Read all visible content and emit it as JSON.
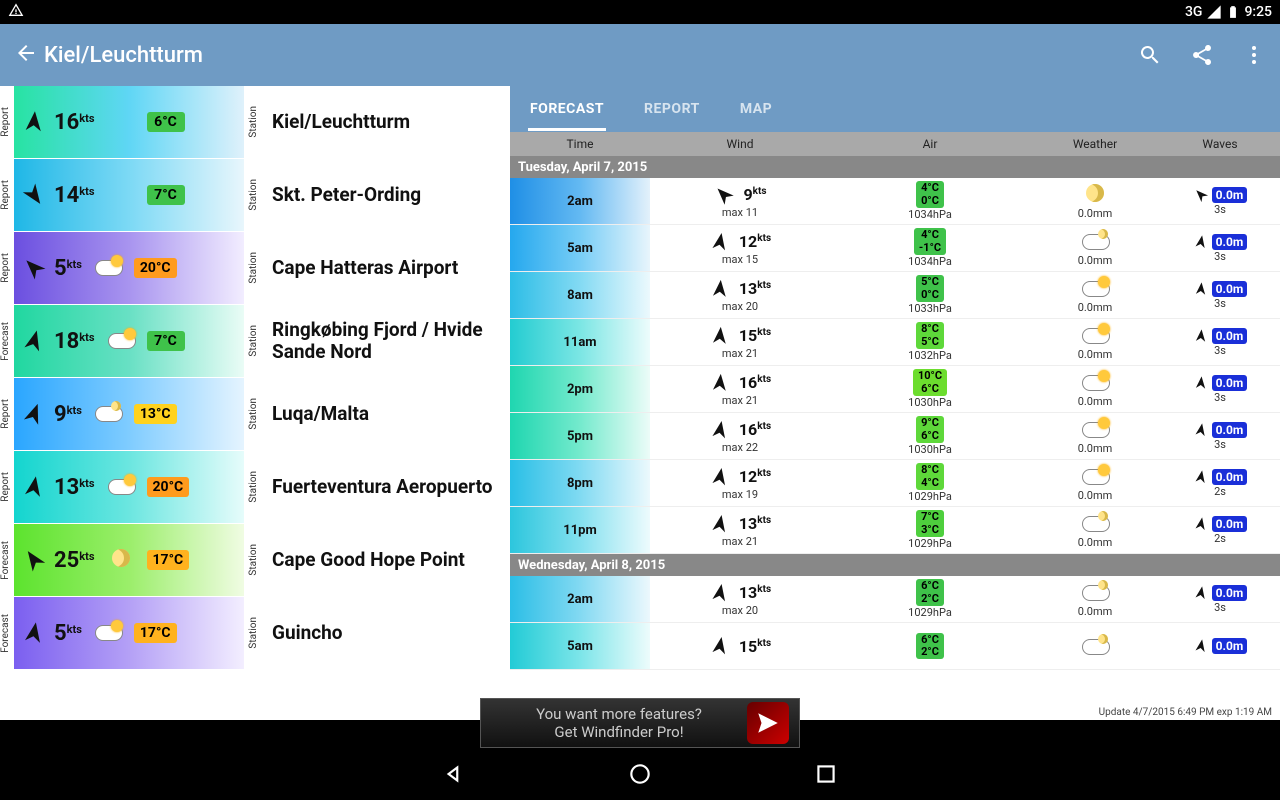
{
  "statusbar": {
    "net": "3G",
    "time": "9:25"
  },
  "toolbar": {
    "title": "Kiel/Leuchtturm"
  },
  "tabs": [
    "FORECAST",
    "REPORT",
    "MAP"
  ],
  "columns": {
    "time": "Time",
    "wind": "Wind",
    "air": "Air",
    "weather": "Weather",
    "waves": "Waves"
  },
  "kts_unit": "kts",
  "stations": [
    {
      "tag": "Report",
      "speed": "16",
      "temp": "6°C",
      "tempbg": "#3fc24a",
      "name": "Kiel/Leuchtturm",
      "grad": "linear-gradient(90deg,#27e3a2,#5fd6f5,#dff1fb)",
      "rot": 95,
      "icon": ""
    },
    {
      "tag": "Report",
      "speed": "14",
      "temp": "7°C",
      "tempbg": "#3fc24a",
      "name": "Skt. Peter-Ording",
      "grad": "linear-gradient(90deg,#1fb7e6,#7cd9f5,#e8f6fc)",
      "rot": 235,
      "icon": ""
    },
    {
      "tag": "Report",
      "speed": "5",
      "temp": "20°C",
      "tempbg": "#ff9b1e",
      "name": "Cape Hatteras Airport",
      "grad": "linear-gradient(90deg,#6b4fe0,#a894ef,#f2edff)",
      "rot": 45,
      "icon": "cloud sun"
    },
    {
      "tag": "Forecast",
      "speed": "18",
      "temp": "7°C",
      "tempbg": "#3fc24a",
      "name": "Ringkøbing Fjord / Hvide Sande Nord",
      "grad": "linear-gradient(90deg,#20d7a0,#68e0c4,#eafcf6)",
      "rot": 105,
      "icon": "cloud sun"
    },
    {
      "tag": "Report",
      "speed": "9",
      "temp": "13°C",
      "tempbg": "#ffd21e",
      "name": "Luqa/Malta",
      "grad": "linear-gradient(90deg,#2aa6ff,#7fccff,#e5f4ff)",
      "rot": 110,
      "icon": "cloud moon"
    },
    {
      "tag": "Report",
      "speed": "13",
      "temp": "20°C",
      "tempbg": "#ff9b1e",
      "name": "Fuerteventura Aeropuerto",
      "grad": "linear-gradient(90deg,#13d5cf,#6be6e0,#e6fcfb)",
      "rot": 100,
      "icon": "cloud sun"
    },
    {
      "tag": "Forecast",
      "speed": "25",
      "temp": "17°C",
      "tempbg": "#ffb21e",
      "name": "Cape Good Hope Point",
      "grad": "linear-gradient(90deg,#5ce32e,#9bee6a,#f0fce3)",
      "rot": 55,
      "icon": "moononly"
    },
    {
      "tag": "Forecast",
      "speed": "5",
      "temp": "17°C",
      "tempbg": "#ffb21e",
      "name": "Guincho",
      "grad": "linear-gradient(90deg,#7b5ff0,#b4a0f6,#f3eeff)",
      "rot": 100,
      "icon": "cloud sun"
    }
  ],
  "days": [
    {
      "label": "Tuesday, April 7, 2015",
      "rows": [
        {
          "t": "2am",
          "sp": "9",
          "mx": "max 11",
          "t1": "4°C",
          "t2": "0°C",
          "tbg": "#3fc24a",
          "hp": "1034hPa",
          "wic": "moononly",
          "mm": "0.0mm",
          "wv": "0.0m",
          "ws": "3s",
          "grad": "linear-gradient(90deg,#1f8fe6,#63b9f2,#e3f1fb)",
          "rot": 45
        },
        {
          "t": "5am",
          "sp": "12",
          "mx": "max 15",
          "t1": "4°C",
          "t2": "-1°C",
          "tbg": "#3fc24a",
          "hp": "1034hPa",
          "wic": "cloud moon",
          "mm": "0.0mm",
          "wv": "0.0m",
          "ws": "3s",
          "grad": "linear-gradient(90deg,#25a8ee,#77cdf6,#e8f5fc)",
          "rot": 100
        },
        {
          "t": "8am",
          "sp": "13",
          "mx": "max 20",
          "t1": "5°C",
          "t2": "0°C",
          "tbg": "#3fc24a",
          "hp": "1033hPa",
          "wic": "cloud sun",
          "mm": "0.0mm",
          "wv": "0.0m",
          "ws": "3s",
          "grad": "linear-gradient(90deg,#2dbde6,#83daf3,#ecf9fd)",
          "rot": 95
        },
        {
          "t": "11am",
          "sp": "15",
          "mx": "max 21",
          "t1": "8°C",
          "t2": "5°C",
          "tbg": "#5ed83a",
          "hp": "1032hPa",
          "wic": "cloud sun",
          "mm": "0.0mm",
          "wv": "0.0m",
          "ws": "3s",
          "grad": "linear-gradient(90deg,#23ccd1,#7be6e4,#edfcfc)",
          "rot": 95
        },
        {
          "t": "2pm",
          "sp": "16",
          "mx": "max 21",
          "t1": "10°C",
          "t2": "6°C",
          "tbg": "#6cdd2e",
          "hp": "1030hPa",
          "wic": "cloud sun",
          "mm": "0.0mm",
          "wv": "0.0m",
          "ws": "3s",
          "grad": "linear-gradient(90deg,#1fd6b0,#74eacd,#ecfcf8)",
          "rot": 95
        },
        {
          "t": "5pm",
          "sp": "16",
          "mx": "max 22",
          "t1": "9°C",
          "t2": "6°C",
          "tbg": "#5ed83a",
          "hp": "1030hPa",
          "wic": "cloud sun",
          "mm": "0.0mm",
          "wv": "0.0m",
          "ws": "3s",
          "grad": "linear-gradient(90deg,#1fd6b0,#74eacd,#ecfcf8)",
          "rot": 100
        },
        {
          "t": "8pm",
          "sp": "12",
          "mx": "max 19",
          "t1": "8°C",
          "t2": "4°C",
          "tbg": "#5ed83a",
          "hp": "1029hPa",
          "wic": "cloud sun",
          "mm": "0.0mm",
          "wv": "0.0m",
          "ws": "2s",
          "grad": "linear-gradient(90deg,#29bfe6,#80daf2,#ecf9fd)",
          "rot": 100
        },
        {
          "t": "11pm",
          "sp": "13",
          "mx": "max 21",
          "t1": "7°C",
          "t2": "3°C",
          "tbg": "#4ecf3d",
          "hp": "1029hPa",
          "wic": "cloud moon",
          "mm": "0.0mm",
          "wv": "0.0m",
          "ws": "2s",
          "grad": "linear-gradient(90deg,#2cc6dd,#83e0ef,#edfbfd)",
          "rot": 100
        }
      ]
    },
    {
      "label": "Wednesday, April 8, 2015",
      "rows": [
        {
          "t": "2am",
          "sp": "13",
          "mx": "max 20",
          "t1": "6°C",
          "t2": "2°C",
          "tbg": "#3fc24a",
          "hp": "1029hPa",
          "wic": "cloud moon",
          "mm": "0.0mm",
          "wv": "0.0m",
          "ws": "3s",
          "grad": "linear-gradient(90deg,#2bbee6,#82d9f2,#ecf8fd)",
          "rot": 100
        },
        {
          "t": "5am",
          "sp": "15",
          "mx": "",
          "t1": "6°C",
          "t2": "2°C",
          "tbg": "#3fc24a",
          "hp": "",
          "wic": "cloud moon",
          "mm": "",
          "wv": "0.0m",
          "ws": "",
          "grad": "linear-gradient(90deg,#22cbd6,#7ce5e9,#edfcfc)",
          "rot": 100
        }
      ]
    }
  ],
  "update_note": "Update 4/7/2015 6:49 PM exp 1:19 AM",
  "ad": {
    "line1": "You want more features?",
    "line2": "Get Windfinder Pro!"
  }
}
